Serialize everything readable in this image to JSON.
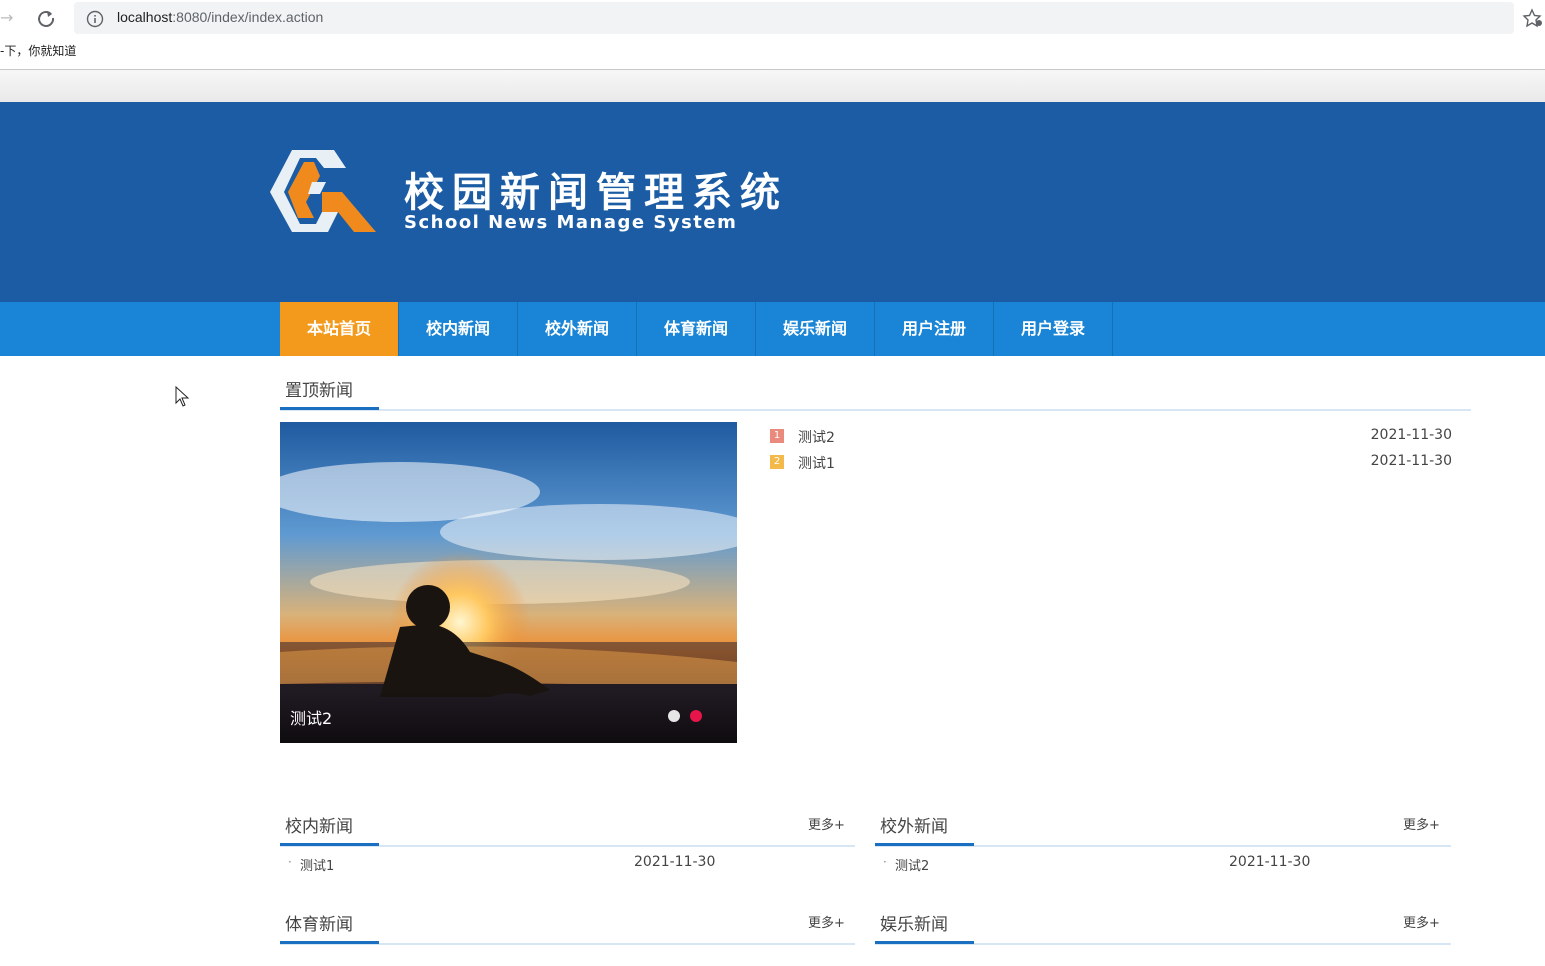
{
  "browser": {
    "url_host": "localhost",
    "url_rest": ":8080/index/index.action",
    "bookmark": "-下，你就知道"
  },
  "header": {
    "title": "校园新闻管理系统",
    "subtitle": "School News Manage System",
    "logo_colors": {
      "orange": "#f08a1d",
      "white": "#ffffff"
    }
  },
  "nav": {
    "items": [
      {
        "label": "本站首页",
        "active": true
      },
      {
        "label": "校内新闻"
      },
      {
        "label": "校外新闻"
      },
      {
        "label": "体育新闻"
      },
      {
        "label": "娱乐新闻"
      },
      {
        "label": "用户注册"
      },
      {
        "label": "用户登录"
      }
    ]
  },
  "top_news": {
    "title": "置顶新闻",
    "slide_caption": "测试2",
    "items": [
      {
        "rank": "1",
        "title": "测试2",
        "date": "2021-11-30"
      },
      {
        "rank": "2",
        "title": "测试1",
        "date": "2021-11-30"
      }
    ]
  },
  "sections": {
    "campus": {
      "title": "校内新闻",
      "more": "更多+",
      "items": [
        {
          "title": "测试1",
          "date": "2021-11-30"
        }
      ]
    },
    "outside": {
      "title": "校外新闻",
      "more": "更多+",
      "items": [
        {
          "title": "测试2",
          "date": "2021-11-30"
        }
      ]
    },
    "sports": {
      "title": "体育新闻",
      "more": "更多+"
    },
    "entertainment": {
      "title": "娱乐新闻",
      "more": "更多+"
    }
  },
  "colors": {
    "header_blue": "#1b5ca4",
    "nav_blue": "#1a85d6",
    "nav_active": "#f39a1c",
    "accent_underline": "#1b6fc1"
  }
}
